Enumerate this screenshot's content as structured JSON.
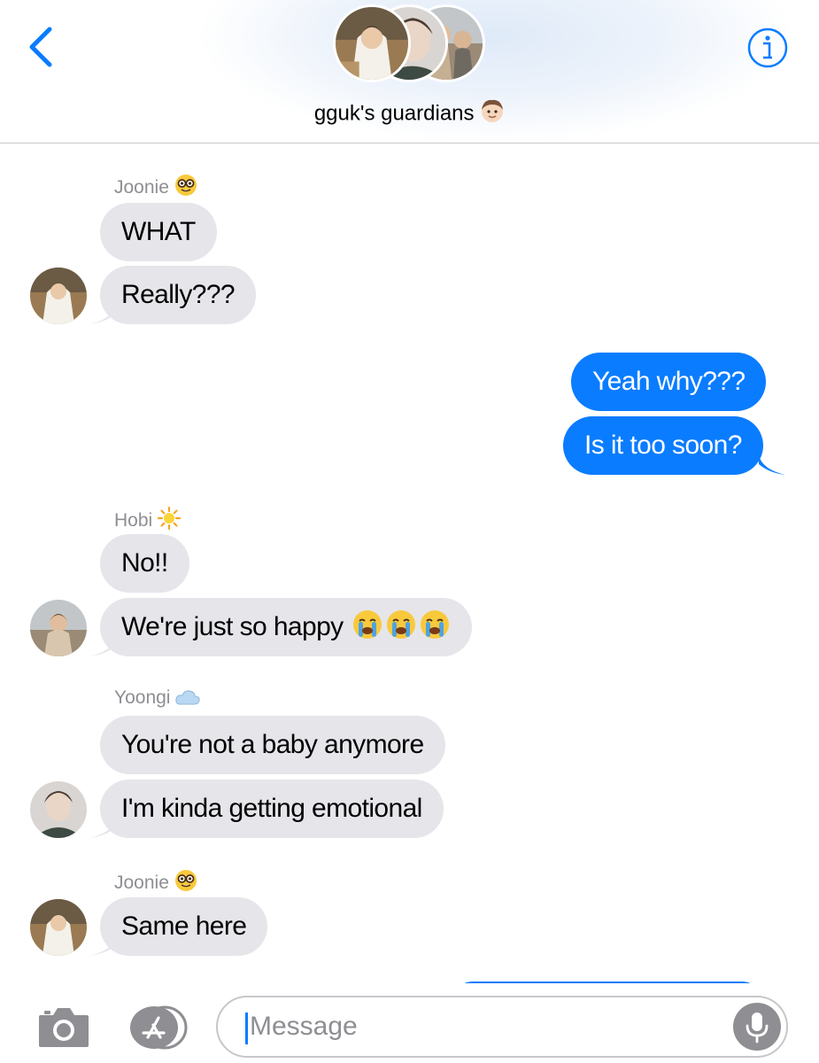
{
  "header": {
    "back_icon": "chevron-left-icon",
    "info_icon": "info-icon",
    "group_name": "gguk's guardians",
    "group_emoji": "boy-face-emoji",
    "avatars": [
      "member-avatar-1",
      "member-avatar-2",
      "member-avatar-3"
    ]
  },
  "colors": {
    "accent": "#0a7cff",
    "incoming_bubble": "#e5e5ea",
    "sender_name": "#8e8e93"
  },
  "messages": [
    {
      "sender": "Joonie",
      "sender_emoji": "nerd-face-emoji",
      "direction": "incoming",
      "texts": [
        "WHAT",
        "Really???"
      ]
    },
    {
      "sender": "",
      "direction": "outgoing",
      "texts": [
        "Yeah why???",
        "Is it too soon?"
      ]
    },
    {
      "sender": "Hobi",
      "sender_emoji": "sun-emoji",
      "direction": "incoming",
      "texts": [
        "No!!",
        "We're just so happy"
      ],
      "trailing_emoji": [
        "crying-face-emoji",
        "crying-face-emoji",
        "crying-face-emoji"
      ]
    },
    {
      "sender": "Yoongi",
      "sender_emoji": "cloud-emoji",
      "direction": "incoming",
      "texts": [
        "You're not a baby anymore",
        "I'm kinda getting emotional"
      ]
    },
    {
      "sender": "Joonie",
      "sender_emoji": "nerd-face-emoji",
      "direction": "incoming",
      "texts": [
        "Same here"
      ]
    }
  ],
  "input_bar": {
    "camera_icon": "camera-icon",
    "apps_icon": "app-store-icon",
    "placeholder": "Message",
    "mic_icon": "microphone-icon"
  }
}
